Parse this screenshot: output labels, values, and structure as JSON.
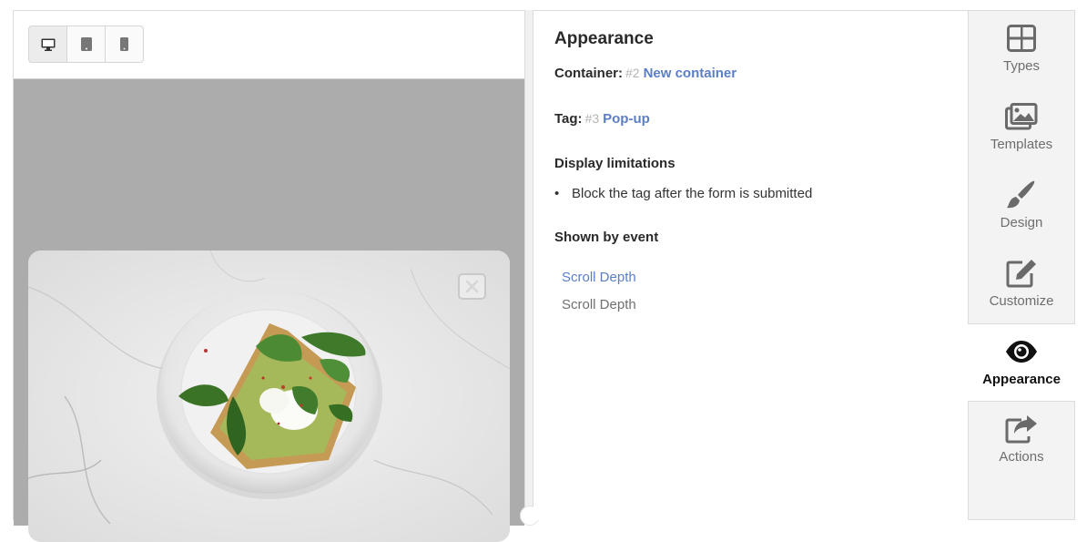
{
  "preview": {
    "device_buttons": [
      {
        "icon": "desktop-icon",
        "active": true
      },
      {
        "icon": "tablet-icon",
        "active": false
      },
      {
        "icon": "mobile-icon",
        "active": false
      }
    ],
    "close_icon": "close-icon"
  },
  "settings": {
    "title": "Appearance",
    "container_label": "Container:",
    "container_num": "#2",
    "container_link": "New container",
    "tag_label": "Tag:",
    "tag_num": "#3",
    "tag_link": "Pop-up",
    "limits_title": "Display limitations",
    "limits_item": "Block the tag after the form is submitted",
    "event_title": "Shown by event",
    "event_link": "Scroll Depth",
    "event_text": "Scroll Depth"
  },
  "nav": {
    "items": [
      {
        "label": "Types",
        "icon": "grid-icon"
      },
      {
        "label": "Templates",
        "icon": "images-icon"
      },
      {
        "label": "Design",
        "icon": "brush-icon"
      },
      {
        "label": "Customize",
        "icon": "edit-icon"
      },
      {
        "label": "Appearance",
        "icon": "eye-icon"
      },
      {
        "label": "Actions",
        "icon": "share-icon"
      }
    ],
    "active": "Appearance"
  },
  "colors": {
    "link": "#5b7fc7",
    "canvas": "#acacac",
    "nav_bg": "#f3f3f3",
    "icon": "#6a6a6a"
  }
}
